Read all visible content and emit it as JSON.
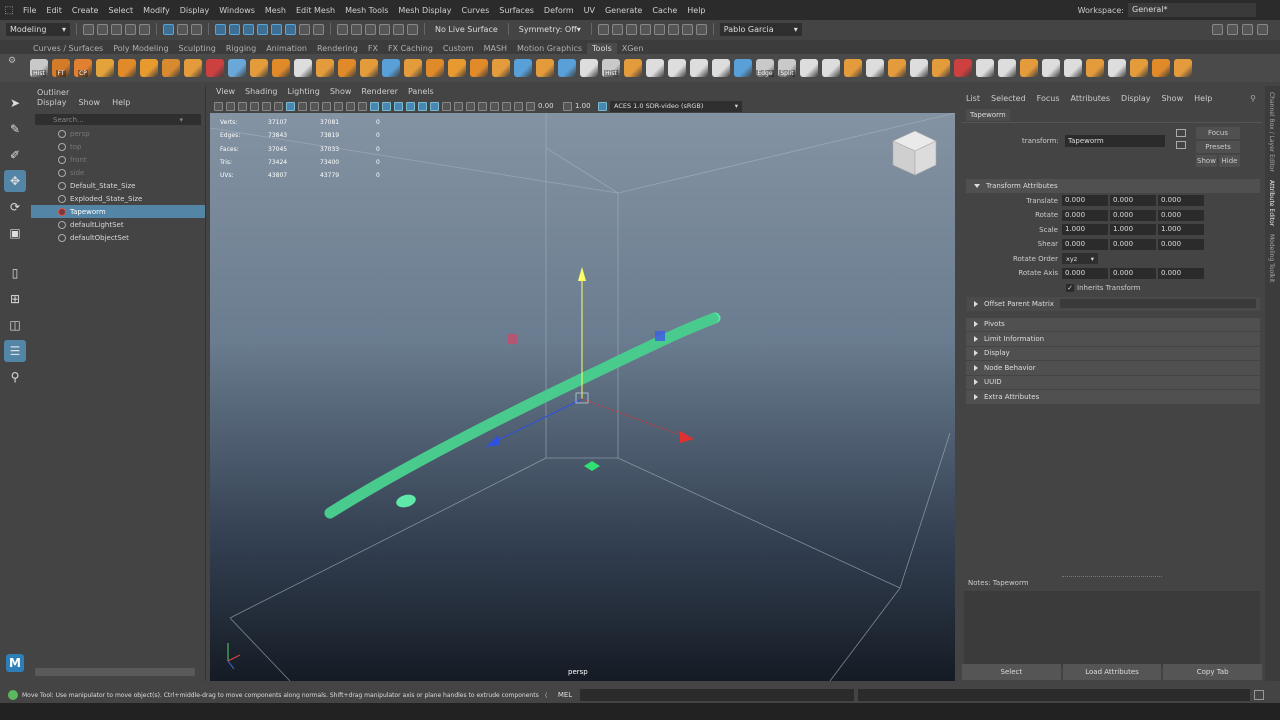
{
  "menubar": {
    "items": [
      "File",
      "Edit",
      "Create",
      "Select",
      "Modify",
      "Display",
      "Windows",
      "Mesh",
      "Edit Mesh",
      "Mesh Tools",
      "Mesh Display",
      "Curves",
      "Surfaces",
      "Deform",
      "UV",
      "Generate",
      "Cache",
      "Help"
    ],
    "workspace_label": "Workspace:",
    "workspace_value": "General*"
  },
  "statusline": {
    "mode": "Modeling",
    "live_surface": "No Live Surface",
    "symmetry": "Symmetry: Off",
    "user": "Pablo Garcia"
  },
  "shelf": {
    "tabs": [
      "Curves / Surfaces",
      "Poly Modeling",
      "Sculpting",
      "Rigging",
      "Animation",
      "Rendering",
      "FX",
      "FX Caching",
      "Custom",
      "MASH",
      "Motion Graphics",
      "Tools",
      "XGen"
    ],
    "active_tab": "Tools",
    "icons": [
      {
        "label": "Hist",
        "c": "#c9c9c9"
      },
      {
        "label": "FT",
        "c": "#d47b2a"
      },
      {
        "label": "CP",
        "c": "#e08030"
      },
      {
        "label": "",
        "c": "#e4a33a"
      },
      {
        "label": "",
        "c": "#e08a2a"
      },
      {
        "label": "",
        "c": "#e69a30"
      },
      {
        "label": "",
        "c": "#d88a2e"
      },
      {
        "label": "",
        "c": "#e49b3b"
      },
      {
        "label": "",
        "c": "#cc4040"
      },
      {
        "label": "",
        "c": "#6aa8d8"
      },
      {
        "label": "",
        "c": "#e49b3b"
      },
      {
        "label": "",
        "c": "#e08a2a"
      },
      {
        "label": "",
        "c": "#dddddd"
      },
      {
        "label": "",
        "c": "#e49b3b"
      },
      {
        "label": "",
        "c": "#e08a2a"
      },
      {
        "label": "",
        "c": "#e49b3b"
      },
      {
        "label": "",
        "c": "#5aa0d8"
      },
      {
        "label": "",
        "c": "#e49b3b"
      },
      {
        "label": "",
        "c": "#e08a2a"
      },
      {
        "label": "",
        "c": "#e69a30"
      },
      {
        "label": "",
        "c": "#e08a2a"
      },
      {
        "label": "",
        "c": "#e49b3b"
      },
      {
        "label": "",
        "c": "#5aa0d8"
      },
      {
        "label": "",
        "c": "#e49b3b"
      },
      {
        "label": "",
        "c": "#5aa0d8"
      },
      {
        "label": "",
        "c": "#dddddd"
      },
      {
        "label": "Hist",
        "c": "#c9c9c9"
      },
      {
        "label": "",
        "c": "#e49b3b"
      },
      {
        "label": "",
        "c": "#dddddd"
      },
      {
        "label": "",
        "c": "#dddddd"
      },
      {
        "label": "",
        "c": "#dddddd"
      },
      {
        "label": "",
        "c": "#dddddd"
      },
      {
        "label": "",
        "c": "#5aa0d8"
      },
      {
        "label": "Edge",
        "c": "#c9c9c9"
      },
      {
        "label": "Split",
        "c": "#c9c9c9"
      },
      {
        "label": "",
        "c": "#dddddd"
      },
      {
        "label": "",
        "c": "#dddddd"
      },
      {
        "label": "",
        "c": "#e49b3b"
      },
      {
        "label": "",
        "c": "#dddddd"
      },
      {
        "label": "",
        "c": "#e49b3b"
      },
      {
        "label": "",
        "c": "#dddddd"
      },
      {
        "label": "",
        "c": "#e49b3b"
      },
      {
        "label": "",
        "c": "#cc4040"
      },
      {
        "label": "",
        "c": "#dddddd"
      },
      {
        "label": "",
        "c": "#dddddd"
      },
      {
        "label": "",
        "c": "#e49b3b"
      },
      {
        "label": "",
        "c": "#dddddd"
      },
      {
        "label": "",
        "c": "#dddddd"
      },
      {
        "label": "",
        "c": "#e49b3b"
      },
      {
        "label": "",
        "c": "#dddddd"
      },
      {
        "label": "",
        "c": "#e49b3b"
      },
      {
        "label": "",
        "c": "#e08a2a"
      },
      {
        "label": "",
        "c": "#e49b3b"
      }
    ]
  },
  "outliner": {
    "title": "Outliner",
    "menu": [
      "Display",
      "Show",
      "Help"
    ],
    "search_placeholder": "Search...",
    "items": [
      {
        "name": "persp",
        "dim": true
      },
      {
        "name": "top",
        "dim": true
      },
      {
        "name": "front",
        "dim": true
      },
      {
        "name": "side",
        "dim": true
      },
      {
        "name": "Default_State_Size",
        "dim": false
      },
      {
        "name": "Exploded_State_Size",
        "dim": false
      },
      {
        "name": "Tapeworm",
        "dim": false,
        "selected": true
      },
      {
        "name": "defaultLightSet",
        "dim": false
      },
      {
        "name": "defaultObjectSet",
        "dim": false
      }
    ]
  },
  "viewport": {
    "menu": [
      "View",
      "Shading",
      "Lighting",
      "Show",
      "Renderer",
      "Panels"
    ],
    "value1": "0.00",
    "value2": "1.00",
    "colorspace": "ACES 1.0 SDR-video (sRGB)",
    "camera": "persp",
    "hud": [
      {
        "k": "Verts:",
        "a": "37107",
        "b": "37081",
        "c": "0"
      },
      {
        "k": "Edges:",
        "a": "73843",
        "b": "73819",
        "c": "0"
      },
      {
        "k": "Faces:",
        "a": "37045",
        "b": "37033",
        "c": "0"
      },
      {
        "k": "Tris:",
        "a": "73424",
        "b": "73400",
        "c": "0"
      },
      {
        "k": "UVs:",
        "a": "43807",
        "b": "43779",
        "c": "0"
      }
    ]
  },
  "attr": {
    "menu": [
      "List",
      "Selected",
      "Focus",
      "Attributes",
      "Display",
      "Show",
      "Help"
    ],
    "tab": "Tapeworm",
    "transform_label": "transform:",
    "transform_value": "Tapeworm",
    "buttons": [
      "Focus",
      "Presets",
      "Show",
      "Hide"
    ],
    "section": "Transform Attributes",
    "rows": [
      {
        "label": "Translate",
        "vals": [
          "0.000",
          "0.000",
          "0.000"
        ]
      },
      {
        "label": "Rotate",
        "vals": [
          "0.000",
          "0.000",
          "0.000"
        ]
      },
      {
        "label": "Scale",
        "vals": [
          "1.000",
          "1.000",
          "1.000"
        ]
      },
      {
        "label": "Shear",
        "vals": [
          "0.000",
          "0.000",
          "0.000"
        ]
      }
    ],
    "rotate_order_label": "Rotate Order",
    "rotate_order": "xyz",
    "rotate_axis_label": "Rotate Axis",
    "rotate_axis": [
      "0.000",
      "0.000",
      "0.000"
    ],
    "inherits": "Inherits Transform",
    "offset": "Offset Parent Matrix",
    "sections": [
      "Pivots",
      "Limit Information",
      "Display",
      "Node Behavior",
      "UUID",
      "Extra Attributes"
    ],
    "notes": "Notes:  Tapeworm",
    "bottom_buttons": [
      "Select",
      "Load Attributes",
      "Copy Tab"
    ]
  },
  "rightstrip": [
    "Channel Box / Layer Editor",
    "Attribute Editor",
    "Modeling Toolkit"
  ],
  "cmdline": {
    "help": "Move Tool: Use manipulator to move object(s). Ctrl+middle-drag to move components along normals. Shift+drag manipulator axis or plane handles to extrude components or c",
    "lang": "MEL"
  },
  "colors": {
    "selection": "#5285a6",
    "mesh": "#5fe8a8"
  }
}
